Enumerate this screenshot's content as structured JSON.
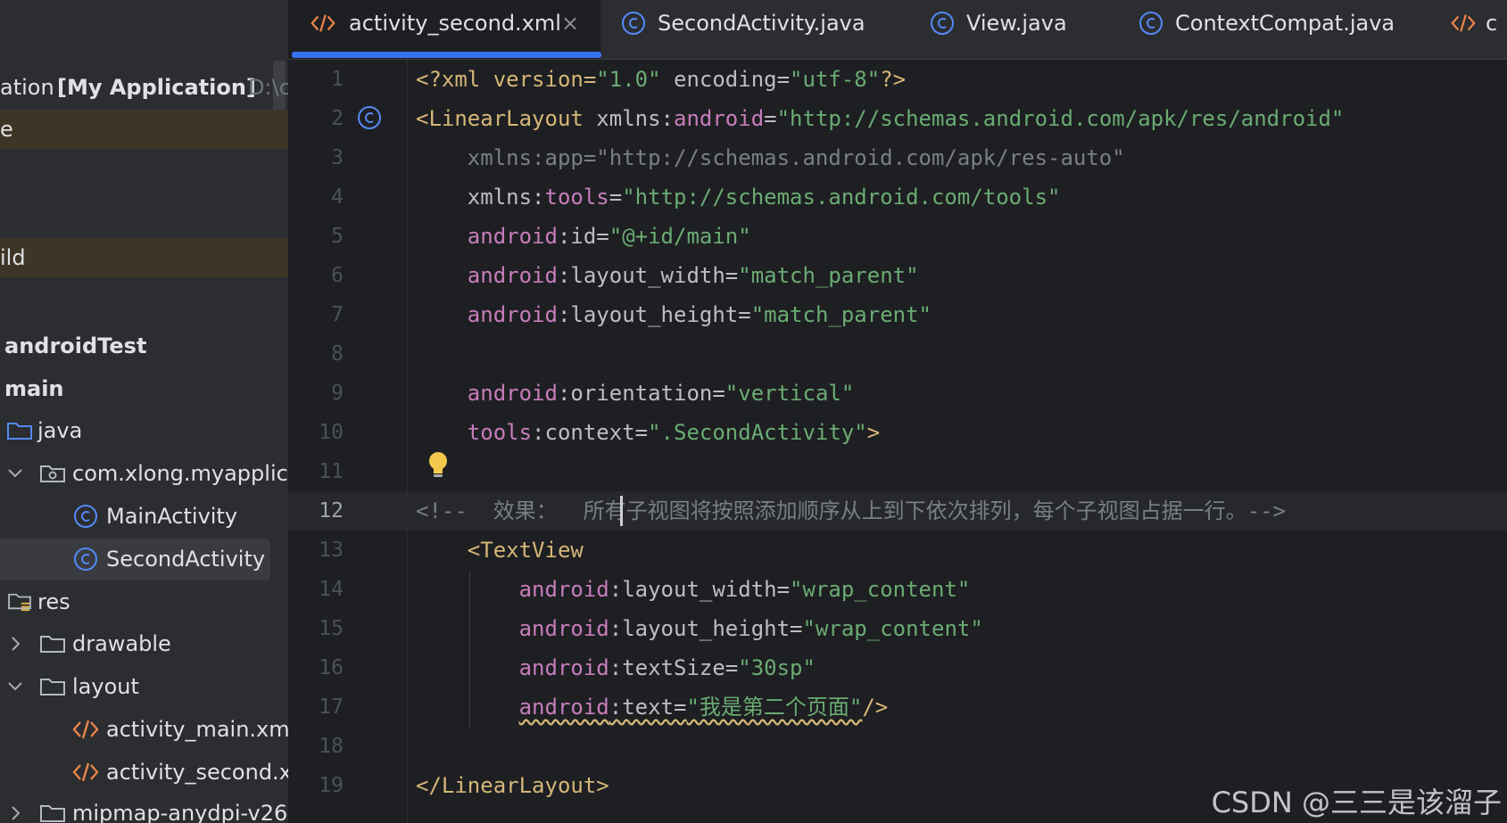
{
  "sidebar": {
    "project_label": "ation",
    "project_bold": "[My Application]",
    "project_path": "D:\\c",
    "row_e": "e",
    "row_build": "ild",
    "android_test": "androidTest",
    "main": "main",
    "java": "java",
    "package": "com.xlong.myapplicat",
    "main_activity": "MainActivity",
    "second_activity": "SecondActivity",
    "res": "res",
    "drawable": "drawable",
    "layout": "layout",
    "activity_main_xml": "activity_main.xml",
    "activity_second_xml": "activity_second.xn",
    "mipmap": "mipmap-anydpi-v26"
  },
  "tabs": [
    {
      "label": "activity_second.xml",
      "icon": "xml-icon",
      "active": true,
      "close": "×"
    },
    {
      "label": "SecondActivity.java",
      "icon": "class-icon"
    },
    {
      "label": "View.java",
      "icon": "class-icon"
    },
    {
      "label": "ContextCompat.java",
      "icon": "class-icon"
    },
    {
      "label": "c",
      "icon": "xml-icon"
    }
  ],
  "editor": {
    "line_numbers": [
      "1",
      "2",
      "3",
      "4",
      "5",
      "6",
      "7",
      "8",
      "9",
      "10",
      "11",
      "12",
      "13",
      "14",
      "15",
      "16",
      "17",
      "18",
      "19"
    ],
    "current_line": "12",
    "lines": {
      "l1_a": "<?xml version=",
      "l1_b": "\"1.0\"",
      "l1_c": " encoding=",
      "l1_d": "\"utf-8\"",
      "l1_e": "?>",
      "l2_a": "<LinearLayout ",
      "l2_b": "xmlns:",
      "l2_c": "android",
      "l2_d": "=",
      "l2_e": "\"http://schemas.android.com/apk/res/android\"",
      "l3": "    xmlns:app=\"http://schemas.android.com/apk/res-auto\"",
      "l4_a": "    xmlns:",
      "l4_b": "tools",
      "l4_c": "=",
      "l4_d": "\"http://schemas.android.com/tools\"",
      "l5_a": "    android",
      "l5_b": ":id=",
      "l5_c": "\"@+id/main\"",
      "l6_a": "    android",
      "l6_b": ":layout_width=",
      "l6_c": "\"match_parent\"",
      "l7_a": "    android",
      "l7_b": ":layout_height=",
      "l7_c": "\"match_parent\"",
      "l9_a": "    android",
      "l9_b": ":orientation=",
      "l9_c": "\"vertical\"",
      "l10_a": "    tools",
      "l10_b": ":context=",
      "l10_c": "\".SecondActivity\"",
      "l10_d": ">",
      "l12": "<!--  效果：  所有子视图将按照添加顺序从上到下依次排列，每个子视图占据一行。-->",
      "l13": "    <TextView",
      "l14_a": "        android",
      "l14_b": ":layout_width=",
      "l14_c": "\"wrap_content\"",
      "l15_a": "        android",
      "l15_b": ":layout_height=",
      "l15_c": "\"wrap_content\"",
      "l16_a": "        android",
      "l16_b": ":textSize=",
      "l16_c": "\"30sp\"",
      "l17_a": "        ",
      "l17_b": "android",
      "l17_c": ":text=",
      "l17_d": "\"我是第二个页面\"",
      "l17_e": "/>",
      "l19": "</LinearLayout>"
    }
  },
  "watermark": "CSDN @三三是该溜子",
  "colors": {
    "accent": "#3574f0",
    "tag": "#d5b778",
    "namespace": "#c77dbb",
    "string": "#6aab73",
    "comment": "#7a7e85"
  }
}
